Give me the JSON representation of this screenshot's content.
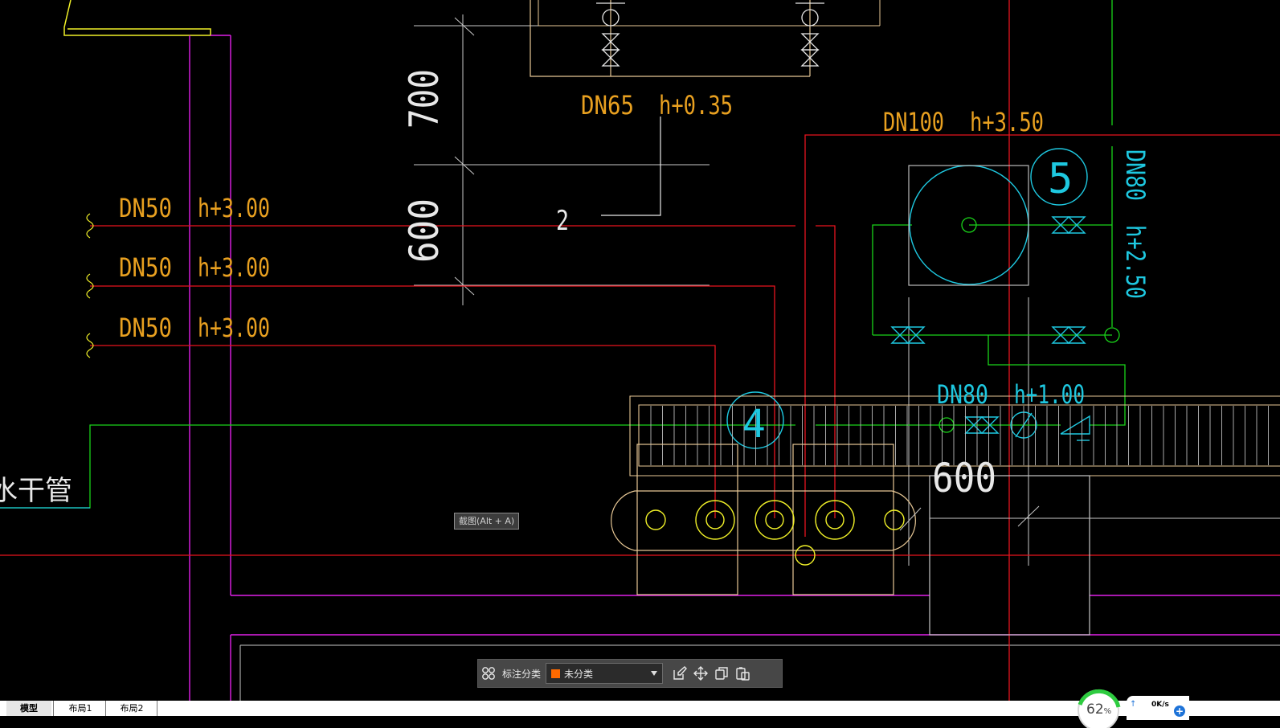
{
  "drawing": {
    "labels": {
      "dn50_a": "DN50",
      "h300_a": "h+3.00",
      "dn50_b": "DN50",
      "h300_b": "h+3.00",
      "dn50_c": "DN50",
      "h300_c": "h+3.00",
      "dn65": "DN65",
      "h035": "h+0.35",
      "dn100": "DN100",
      "h350": "h+3.50",
      "dn80_v": "DN80",
      "h250_v": "h+2.50",
      "dn80": "DN80",
      "h100": "h+1.00",
      "dim700": "700",
      "dim600_v": "600",
      "dim600": "600",
      "num2": "2",
      "num4": "4",
      "num5": "5",
      "main_pipe": "水干管"
    },
    "colors": {
      "red": "#e8141e",
      "magenta": "#e020e8",
      "green": "#19d419",
      "cyan": "#1ec8e0",
      "yellow": "#f0f028",
      "orange": "#e0a030",
      "white": "#c8c8c8",
      "wheat": "#e8c896"
    }
  },
  "tooltip": "截图(Alt + A)",
  "annotation_bar": {
    "label": "标注分类",
    "category_value": "未分类",
    "category_color": "#ff6a00",
    "tools": [
      "grid-icon",
      "edit-icon",
      "move-icon",
      "copy-icon",
      "paste-icon"
    ]
  },
  "tabs": [
    "模型",
    "布局1",
    "布局2"
  ],
  "status": {
    "cpu_percent": "62",
    "cpu_unit": "%",
    "net_speed": "0K/s"
  }
}
